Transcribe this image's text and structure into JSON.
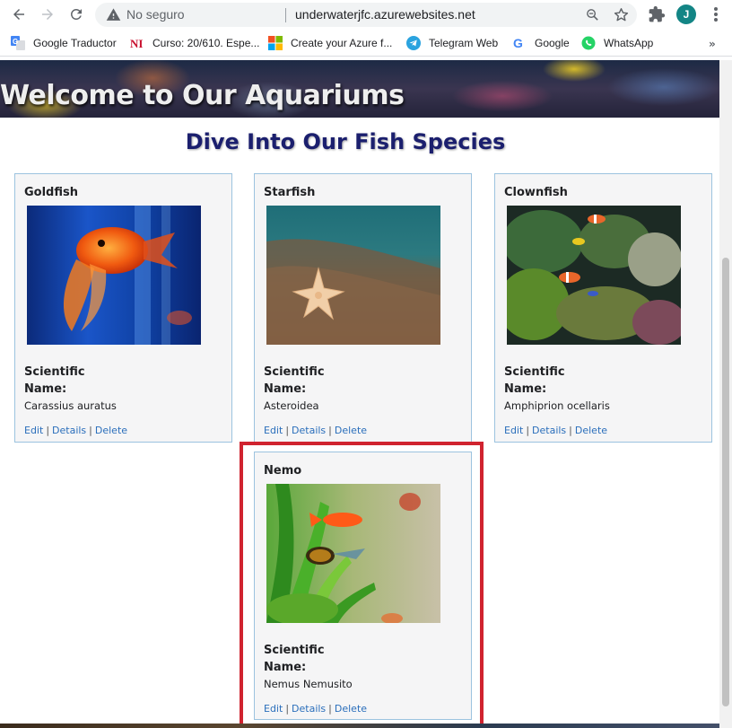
{
  "browser": {
    "security_label": "No seguro",
    "url": "underwaterjfc.azurewebsites.net",
    "profile_initial": "J",
    "bookmarks": [
      {
        "label": "Google Traductor",
        "icon": "google-translate-icon"
      },
      {
        "label": "Curso: 20/610. Espe...",
        "icon": "ni-icon"
      },
      {
        "label": "Create your Azure f...",
        "icon": "microsoft-icon"
      },
      {
        "label": "Telegram Web",
        "icon": "telegram-icon"
      },
      {
        "label": "Google",
        "icon": "google-icon"
      },
      {
        "label": "WhatsApp",
        "icon": "whatsapp-icon"
      }
    ],
    "bookmarks_overflow": "»"
  },
  "page": {
    "hero_title": "Welcome to Our Aquariums",
    "subtitle": "Dive Into Our Fish Species",
    "scientific_label": "Scientific Name:",
    "link_edit": "Edit",
    "link_details": "Details",
    "link_delete": "Delete",
    "link_separator": "|",
    "fish": [
      {
        "name": "Goldfish",
        "scientific_name": "Carassius auratus"
      },
      {
        "name": "Starfish",
        "scientific_name": "Asteroidea"
      },
      {
        "name": "Clownfish",
        "scientific_name": "Amphiprion ocellaris"
      },
      {
        "name": "Nemo",
        "scientific_name": "Nemus Nemusito"
      }
    ]
  },
  "colors": {
    "subtitle": "#1b1f6e",
    "card_border": "#9cc3df",
    "link": "#2a6ebb",
    "highlight_border": "#d0232f"
  }
}
